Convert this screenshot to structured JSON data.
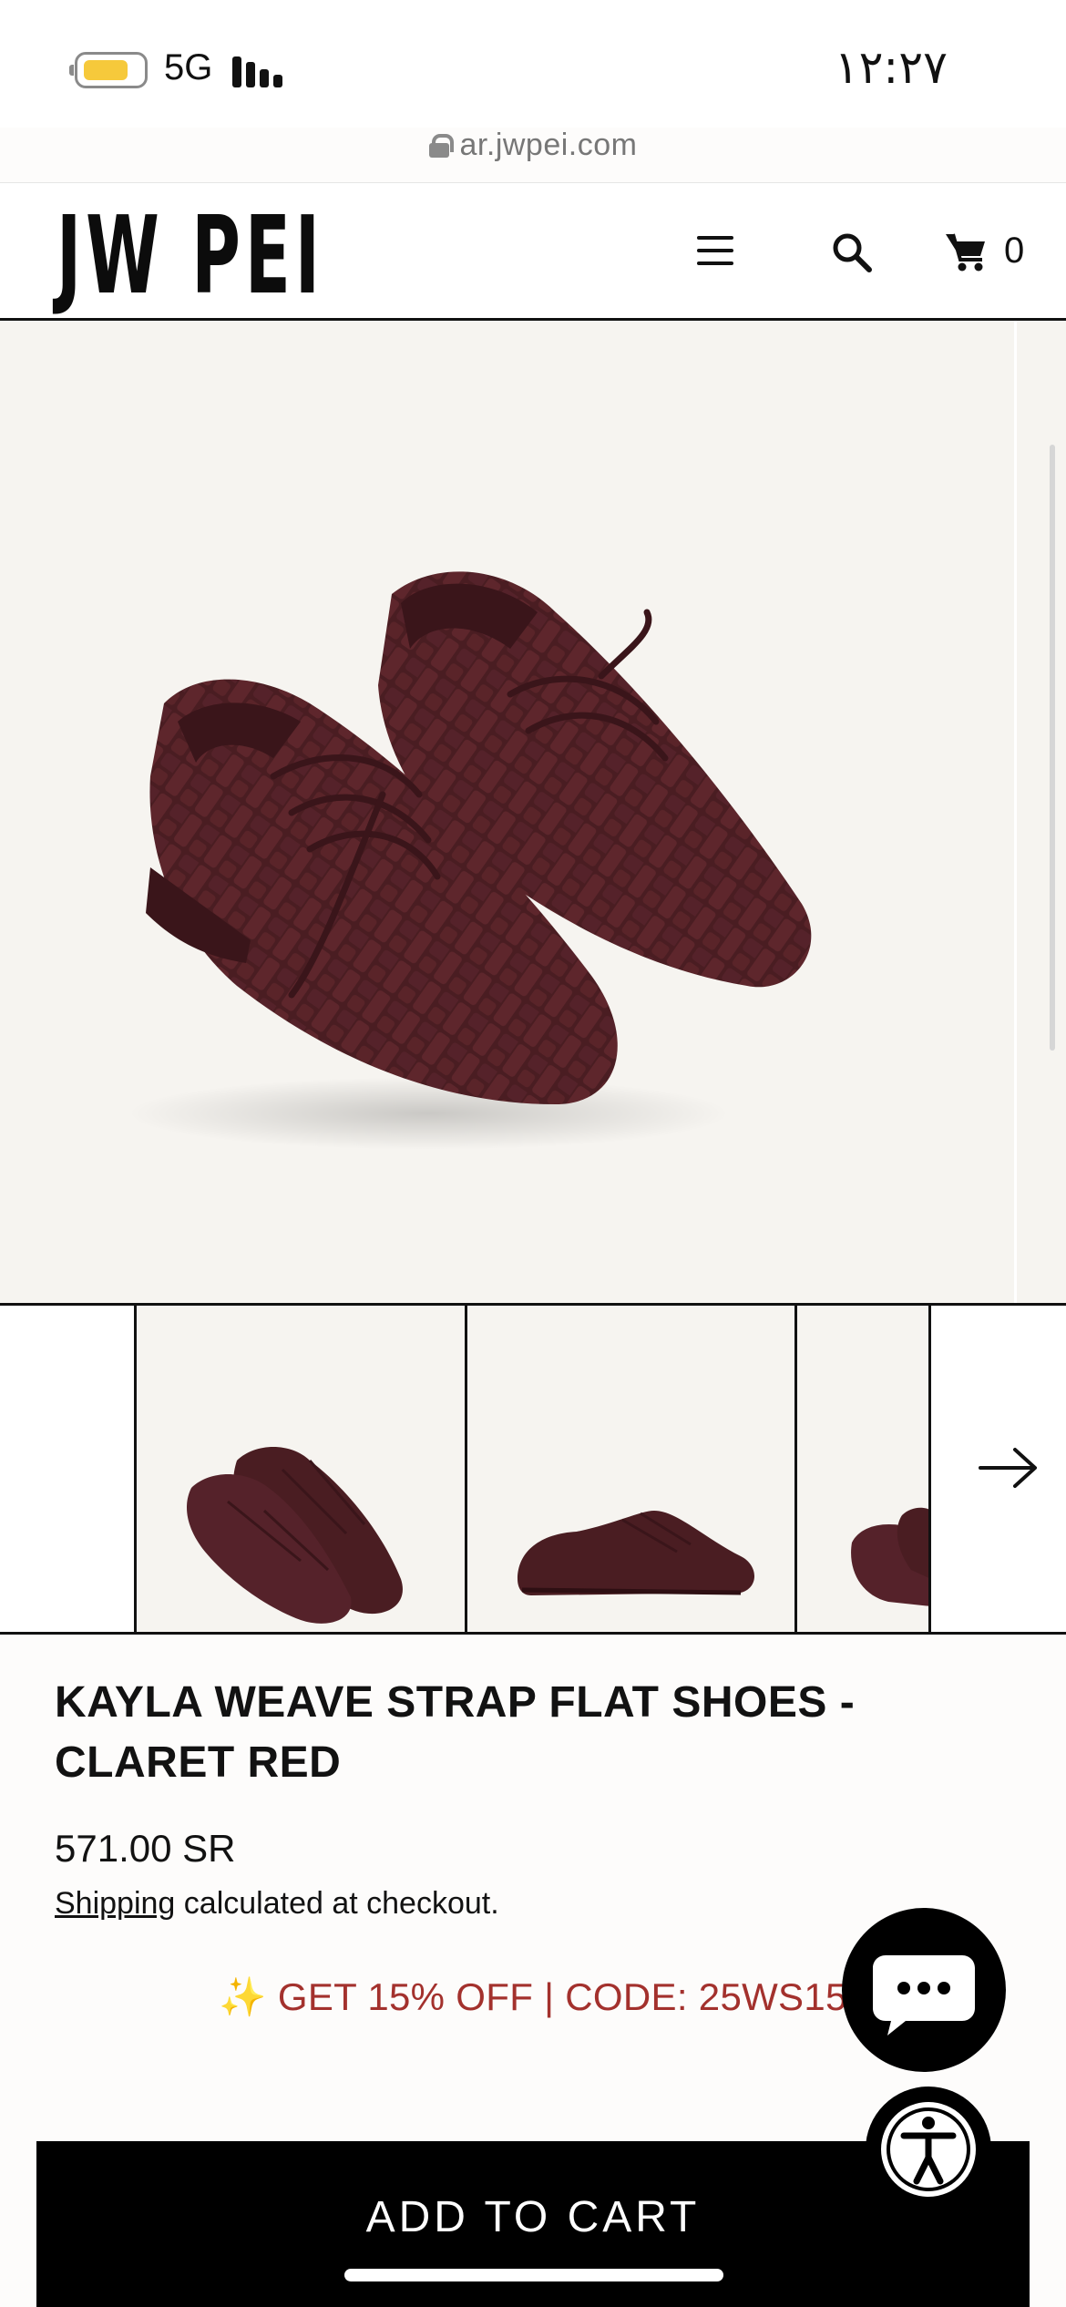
{
  "status_bar": {
    "network": "5G",
    "time": "۱۲:۲۷"
  },
  "browser": {
    "url": "ar.jwpei.com"
  },
  "header": {
    "logo": "JW PEI",
    "cart_count": "0"
  },
  "product": {
    "title": "KAYLA WEAVE STRAP FLAT SHOES - CLARET RED",
    "price": "571.00 SR",
    "shipping_link": "Shipping",
    "shipping_text": " calculated at checkout.",
    "promo": "✨ GET 15% OFF | CODE: 25WS15",
    "color": "#4a1d22"
  },
  "actions": {
    "add_to_cart": "ADD TO CART"
  },
  "colors": {
    "promo": "#a3312d",
    "button_bg": "#000000",
    "image_bg": "#f6f4f0"
  },
  "icons": [
    "battery-icon",
    "signal-icon",
    "lock-icon",
    "menu-icon",
    "search-icon",
    "cart-icon",
    "arrow-right-icon",
    "chat-icon",
    "accessibility-icon"
  ]
}
